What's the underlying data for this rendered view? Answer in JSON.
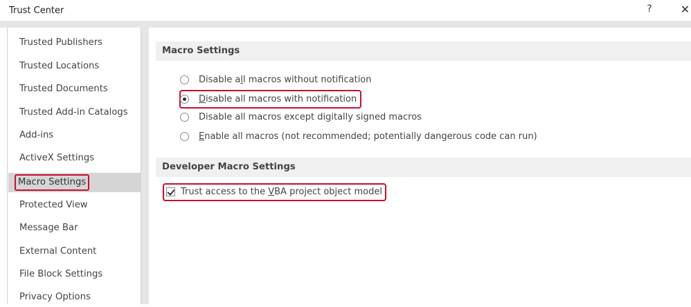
{
  "window": {
    "title": "Trust Center",
    "help_label": "?",
    "close_label": "✕"
  },
  "sidebar": {
    "selected_index": 6,
    "items": [
      {
        "label": "Trusted Publishers"
      },
      {
        "label": "Trusted Locations"
      },
      {
        "label": "Trusted Documents"
      },
      {
        "label": "Trusted Add-in Catalogs"
      },
      {
        "label": "Add-ins"
      },
      {
        "label": "ActiveX Settings"
      },
      {
        "label": "Macro Settings"
      },
      {
        "label": "Protected View"
      },
      {
        "label": "Message Bar"
      },
      {
        "label": "External Content"
      },
      {
        "label": "File Block Settings"
      },
      {
        "label": "Privacy Options"
      }
    ]
  },
  "macro_settings": {
    "header": "Macro Settings",
    "options": [
      {
        "pre": "Disable a",
        "key": "l",
        "post": "l macros without notification",
        "checked": false
      },
      {
        "pre": "",
        "key": "D",
        "post": "isable all macros with notification",
        "checked": true
      },
      {
        "pre": "Disable all macros except di",
        "key": "g",
        "post": "itally signed macros",
        "checked": false
      },
      {
        "pre": "",
        "key": "E",
        "post": "nable all macros (not recommended; potentially dangerous code can run)",
        "checked": false
      }
    ]
  },
  "developer_settings": {
    "header": "Developer Macro Settings",
    "trust_vba": {
      "pre": "Trust access to the ",
      "key": "V",
      "post": "BA project object model",
      "checked": true
    }
  },
  "colors": {
    "highlight": "#c8102e",
    "selected_bg": "#d5d5d5",
    "header_bg": "#f0f0f0",
    "dialog_bg": "#e6e6e6"
  }
}
